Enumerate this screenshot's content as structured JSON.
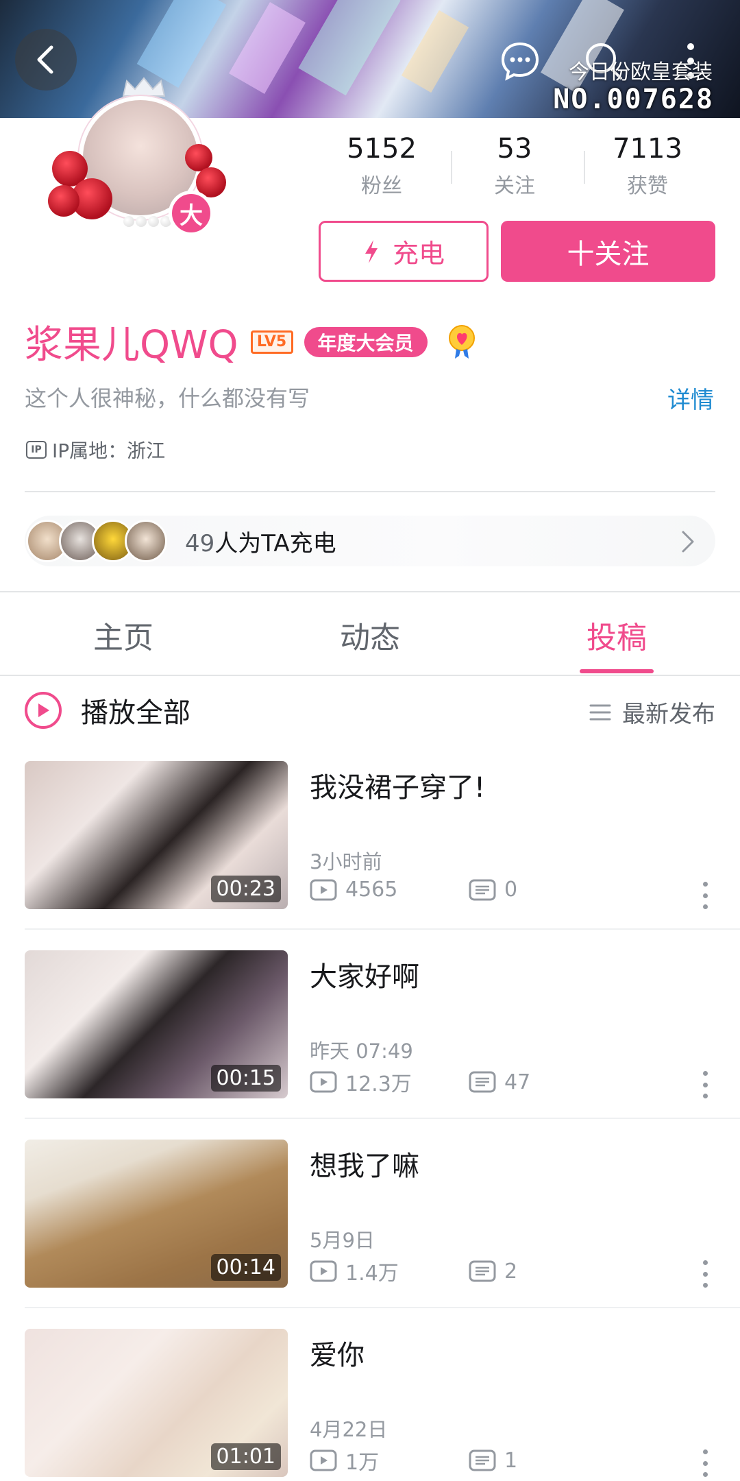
{
  "header": {
    "suit_text": "今日份欧皇套装",
    "suit_number": "NO.007628"
  },
  "profile": {
    "avatar_badge": "大",
    "stats": [
      {
        "value": "5152",
        "label": "粉丝"
      },
      {
        "value": "53",
        "label": "关注"
      },
      {
        "value": "7113",
        "label": "获赞"
      }
    ],
    "charge_button": "充电",
    "follow_button": "十关注",
    "name": "浆果儿QWQ",
    "level": "LV5",
    "vip_tag": "年度大会员",
    "signature": "这个人很神秘，什么都没有写",
    "detail_link": "详情",
    "ip_icon": "IP",
    "ip_location": "IP属地：浙江",
    "charge_bar": {
      "count": "49",
      "text": "人为TA充电"
    }
  },
  "tabs": [
    {
      "label": "主页",
      "active": false
    },
    {
      "label": "动态",
      "active": false
    },
    {
      "label": "投稿",
      "active": true
    }
  ],
  "list_header": {
    "play_all": "播放全部",
    "sort": "最新发布"
  },
  "videos": [
    {
      "title": "我没裙子穿了!",
      "date": "3小时前",
      "views": "4565",
      "comments": "0",
      "duration": "00:23"
    },
    {
      "title": "大家好啊",
      "date": "昨天 07:49",
      "views": "12.3万",
      "comments": "47",
      "duration": "00:15"
    },
    {
      "title": "想我了嘛",
      "date": "5月9日",
      "views": "1.4万",
      "comments": "2",
      "duration": "00:14"
    },
    {
      "title": "爱你",
      "date": "4月22日",
      "views": "1万",
      "comments": "1",
      "duration": "01:01"
    }
  ],
  "colors": {
    "accent": "#f04b8c",
    "link": "#1f8bd1",
    "level": "#ff6b24"
  }
}
